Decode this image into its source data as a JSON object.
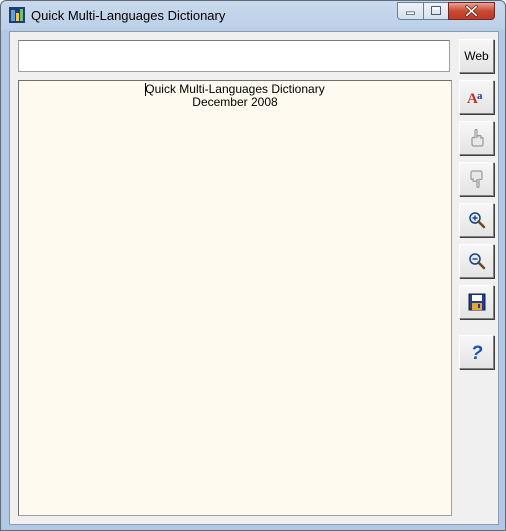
{
  "window": {
    "title": "Quick Multi-Languages Dictionary"
  },
  "search": {
    "value": "",
    "placeholder": ""
  },
  "result": {
    "line1": "Quick Multi-Languages Dictionary",
    "line2": "December 2008"
  },
  "toolbar": {
    "web_label": "Web",
    "buttons": [
      {
        "name": "web-button",
        "icon": "text-web"
      },
      {
        "name": "font-button",
        "icon": "font-aa-icon"
      },
      {
        "name": "hand-up-button",
        "icon": "hand-up-icon"
      },
      {
        "name": "hand-down-button",
        "icon": "hand-down-icon"
      },
      {
        "name": "zoom-in-button",
        "icon": "zoom-in-icon"
      },
      {
        "name": "zoom-out-button",
        "icon": "zoom-out-icon"
      },
      {
        "name": "save-button",
        "icon": "floppy-disk-icon"
      },
      {
        "name": "help-button",
        "icon": "question-mark-icon"
      }
    ]
  },
  "colors": {
    "result_background": "#fffaf0",
    "client_background": "#f0f0f0",
    "close_button": "#c84a32",
    "help_icon": "#1b52b3"
  }
}
